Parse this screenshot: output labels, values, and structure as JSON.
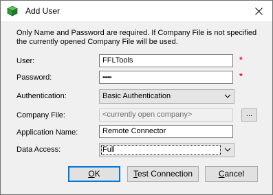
{
  "window": {
    "title": "Add User",
    "close_glyph": "close-icon"
  },
  "notice": "Only Name and Password are required. If Company File is not specified the currently opened Company File will be used.",
  "form": {
    "user": {
      "label": "User:",
      "value": "FFLTools",
      "required_marker": "*"
    },
    "password": {
      "label": "Password:",
      "value": "•••••••",
      "required_marker": "*"
    },
    "authentication": {
      "label": "Authentication:",
      "value": "Basic Authentication"
    },
    "company_file": {
      "label": "Company File:",
      "value": "<currently open company>",
      "browse_label": "..."
    },
    "application_name": {
      "label": "Application Name:",
      "value": "Remote Connector"
    },
    "data_access": {
      "label": "Data Access:",
      "value": "Full"
    }
  },
  "buttons": {
    "ok": {
      "mnemonic": "O",
      "rest": "K"
    },
    "test": {
      "mnemonic": "T",
      "rest": "est Connection"
    },
    "cancel": {
      "mnemonic": "C",
      "rest": "ancel"
    }
  },
  "colors": {
    "required": "#e81123",
    "accent": "#0078d7"
  }
}
